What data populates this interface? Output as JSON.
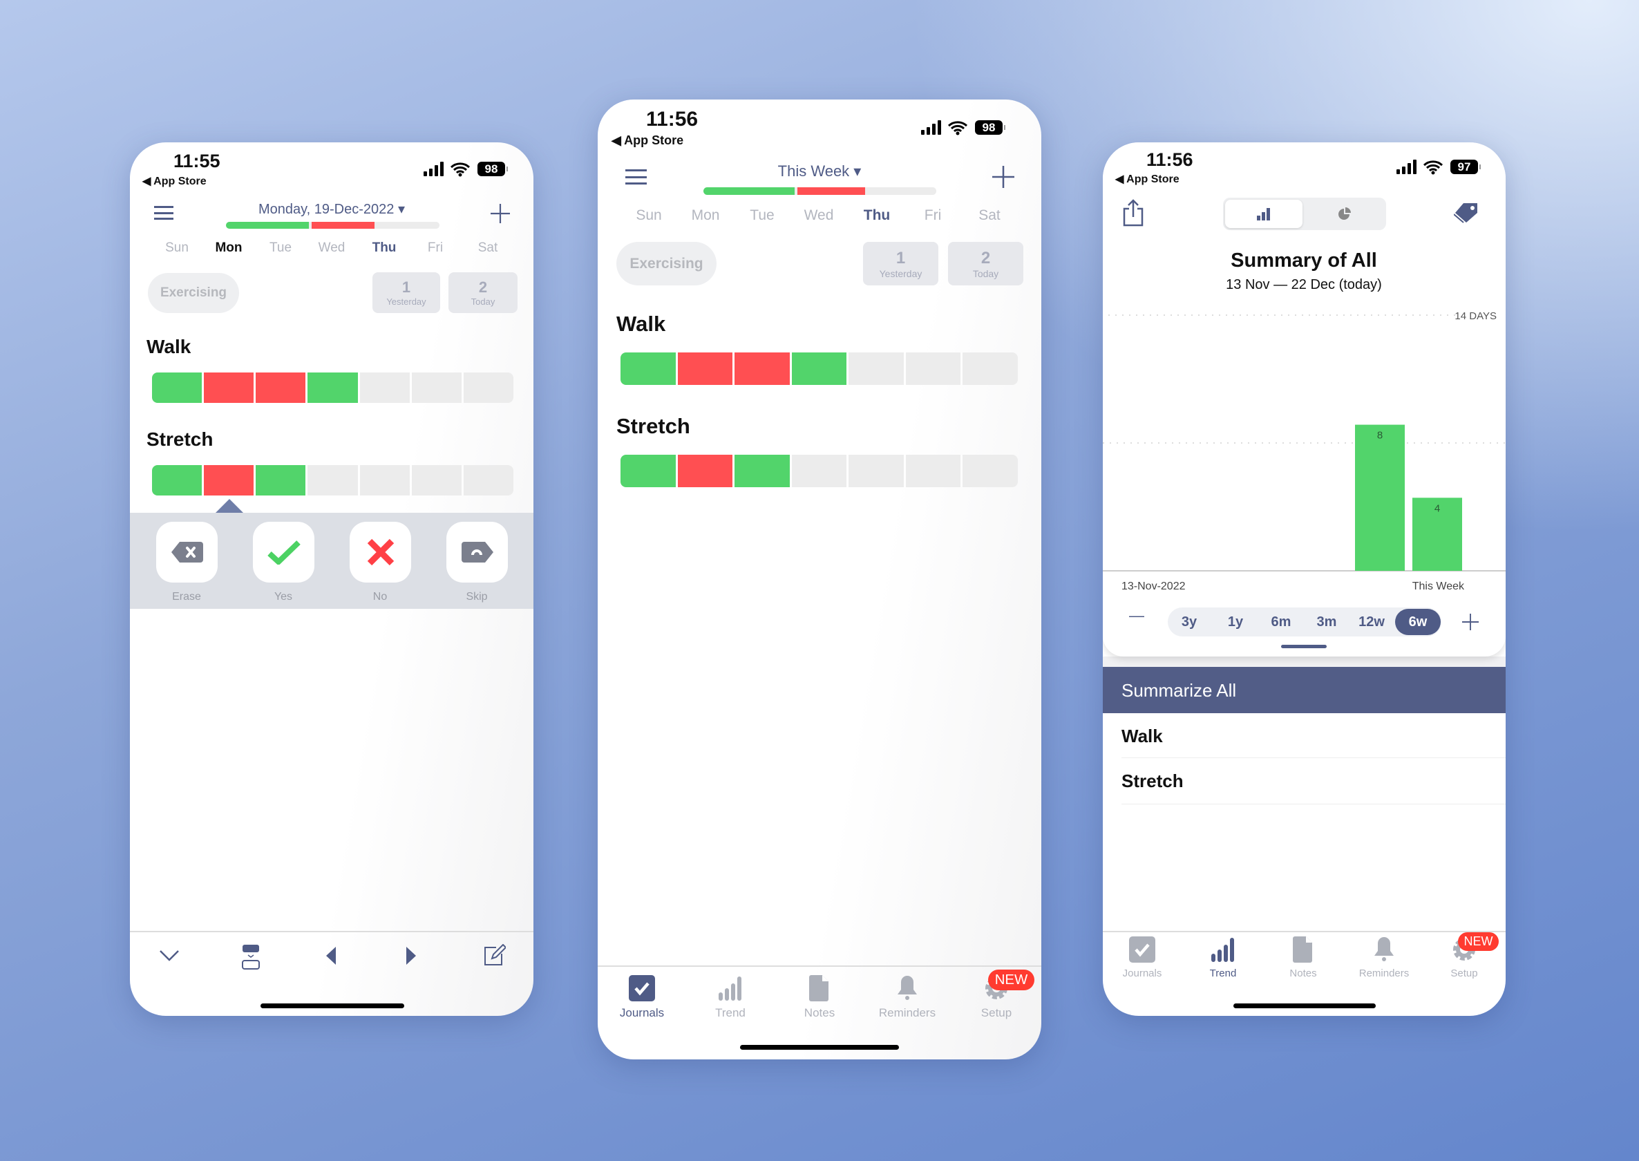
{
  "colors": {
    "yes": "#52d46b",
    "no": "#ff4f52",
    "empty": "#ececec",
    "accent": "#4f5b86",
    "badge": "#ff3b30"
  },
  "phone1": {
    "status": {
      "time": "11:55",
      "back": "◀ App Store",
      "battery": "98"
    },
    "header": {
      "title": "Monday, 19-Dec-2022 ▾",
      "progress": {
        "yes": 0.4,
        "no": 0.3
      }
    },
    "days": [
      "Sun",
      "Mon",
      "Tue",
      "Wed",
      "Thu",
      "Fri",
      "Sat"
    ],
    "selected_day": "Mon",
    "today": "Thu",
    "filter": "Exercising",
    "counters": [
      {
        "n": "1",
        "label": "Yesterday"
      },
      {
        "n": "2",
        "label": "Today"
      }
    ],
    "habits": [
      {
        "name": "Walk",
        "cells": [
          "yes",
          "no",
          "no",
          "yes",
          "empty",
          "empty",
          "empty"
        ]
      },
      {
        "name": "Stretch",
        "cells": [
          "yes",
          "no",
          "yes",
          "empty",
          "empty",
          "empty",
          "empty"
        ]
      }
    ],
    "actions": [
      {
        "label": "Erase",
        "icon": "erase-icon"
      },
      {
        "label": "Yes",
        "icon": "check-icon"
      },
      {
        "label": "No",
        "icon": "x-icon"
      },
      {
        "label": "Skip",
        "icon": "skip-icon"
      }
    ],
    "toolbar": [
      "chevron-down-icon",
      "collapse-icon",
      "previous-icon",
      "next-icon",
      "edit-icon"
    ]
  },
  "phone2": {
    "status": {
      "time": "11:56",
      "back": "◀ App Store",
      "battery": "98"
    },
    "header": {
      "title": "This Week ▾",
      "progress": {
        "yes": 0.4,
        "no": 0.3
      }
    },
    "days": [
      "Sun",
      "Mon",
      "Tue",
      "Wed",
      "Thu",
      "Fri",
      "Sat"
    ],
    "today": "Thu",
    "filter": "Exercising",
    "counters": [
      {
        "n": "1",
        "label": "Yesterday"
      },
      {
        "n": "2",
        "label": "Today"
      }
    ],
    "habits": [
      {
        "name": "Walk",
        "cells": [
          "yes",
          "no",
          "no",
          "yes",
          "empty",
          "empty",
          "empty"
        ]
      },
      {
        "name": "Stretch",
        "cells": [
          "yes",
          "no",
          "yes",
          "empty",
          "empty",
          "empty",
          "empty"
        ]
      }
    ],
    "tabs": [
      {
        "label": "Journals",
        "icon": "journals-icon",
        "active": true
      },
      {
        "label": "Trend",
        "icon": "trend-icon"
      },
      {
        "label": "Notes",
        "icon": "notes-icon"
      },
      {
        "label": "Reminders",
        "icon": "bell-icon"
      },
      {
        "label": "Setup",
        "icon": "gear-icon",
        "badge": "NEW"
      }
    ]
  },
  "phone3": {
    "status": {
      "time": "11:56",
      "back": "◀ App Store",
      "battery": "97"
    },
    "title": "Summary of All",
    "subtitle": "13 Nov — 22 Dec (today)",
    "ranges": [
      "3y",
      "1y",
      "6m",
      "3m",
      "12w",
      "6w"
    ],
    "selected_range": "6w",
    "list_header": "Summarize All",
    "list": [
      "Walk",
      "Stretch"
    ],
    "tabs": [
      {
        "label": "Journals",
        "icon": "journals-icon"
      },
      {
        "label": "Trend",
        "icon": "trend-icon",
        "active": true
      },
      {
        "label": "Notes",
        "icon": "notes-icon"
      },
      {
        "label": "Reminders",
        "icon": "bell-icon"
      },
      {
        "label": "Setup",
        "icon": "gear-icon",
        "badge": "NEW"
      }
    ]
  },
  "chart_data": {
    "type": "bar",
    "categories": [
      "",
      "",
      "",
      "",
      "",
      "This Week"
    ],
    "values": [
      0,
      0,
      0,
      0,
      8,
      4
    ],
    "ylim": [
      0,
      14
    ],
    "ytick_label": "14 DAYS",
    "x_start_label": "13-Nov-2022",
    "x_end_label": "This Week",
    "grid": true,
    "bar_color": "#52d46b"
  }
}
